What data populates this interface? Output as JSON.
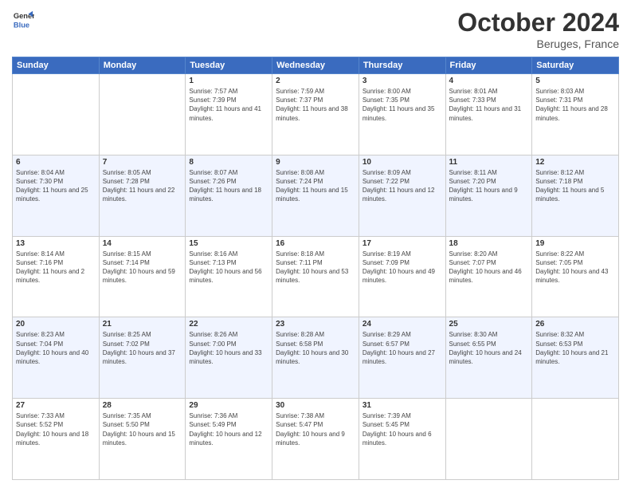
{
  "header": {
    "logo_line1": "General",
    "logo_line2": "Blue",
    "month": "October 2024",
    "location": "Beruges, France"
  },
  "days_of_week": [
    "Sunday",
    "Monday",
    "Tuesday",
    "Wednesday",
    "Thursday",
    "Friday",
    "Saturday"
  ],
  "weeks": [
    [
      {
        "day": "",
        "info": ""
      },
      {
        "day": "",
        "info": ""
      },
      {
        "day": "1",
        "info": "Sunrise: 7:57 AM\nSunset: 7:39 PM\nDaylight: 11 hours and 41 minutes."
      },
      {
        "day": "2",
        "info": "Sunrise: 7:59 AM\nSunset: 7:37 PM\nDaylight: 11 hours and 38 minutes."
      },
      {
        "day": "3",
        "info": "Sunrise: 8:00 AM\nSunset: 7:35 PM\nDaylight: 11 hours and 35 minutes."
      },
      {
        "day": "4",
        "info": "Sunrise: 8:01 AM\nSunset: 7:33 PM\nDaylight: 11 hours and 31 minutes."
      },
      {
        "day": "5",
        "info": "Sunrise: 8:03 AM\nSunset: 7:31 PM\nDaylight: 11 hours and 28 minutes."
      }
    ],
    [
      {
        "day": "6",
        "info": "Sunrise: 8:04 AM\nSunset: 7:30 PM\nDaylight: 11 hours and 25 minutes."
      },
      {
        "day": "7",
        "info": "Sunrise: 8:05 AM\nSunset: 7:28 PM\nDaylight: 11 hours and 22 minutes."
      },
      {
        "day": "8",
        "info": "Sunrise: 8:07 AM\nSunset: 7:26 PM\nDaylight: 11 hours and 18 minutes."
      },
      {
        "day": "9",
        "info": "Sunrise: 8:08 AM\nSunset: 7:24 PM\nDaylight: 11 hours and 15 minutes."
      },
      {
        "day": "10",
        "info": "Sunrise: 8:09 AM\nSunset: 7:22 PM\nDaylight: 11 hours and 12 minutes."
      },
      {
        "day": "11",
        "info": "Sunrise: 8:11 AM\nSunset: 7:20 PM\nDaylight: 11 hours and 9 minutes."
      },
      {
        "day": "12",
        "info": "Sunrise: 8:12 AM\nSunset: 7:18 PM\nDaylight: 11 hours and 5 minutes."
      }
    ],
    [
      {
        "day": "13",
        "info": "Sunrise: 8:14 AM\nSunset: 7:16 PM\nDaylight: 11 hours and 2 minutes."
      },
      {
        "day": "14",
        "info": "Sunrise: 8:15 AM\nSunset: 7:14 PM\nDaylight: 10 hours and 59 minutes."
      },
      {
        "day": "15",
        "info": "Sunrise: 8:16 AM\nSunset: 7:13 PM\nDaylight: 10 hours and 56 minutes."
      },
      {
        "day": "16",
        "info": "Sunrise: 8:18 AM\nSunset: 7:11 PM\nDaylight: 10 hours and 53 minutes."
      },
      {
        "day": "17",
        "info": "Sunrise: 8:19 AM\nSunset: 7:09 PM\nDaylight: 10 hours and 49 minutes."
      },
      {
        "day": "18",
        "info": "Sunrise: 8:20 AM\nSunset: 7:07 PM\nDaylight: 10 hours and 46 minutes."
      },
      {
        "day": "19",
        "info": "Sunrise: 8:22 AM\nSunset: 7:05 PM\nDaylight: 10 hours and 43 minutes."
      }
    ],
    [
      {
        "day": "20",
        "info": "Sunrise: 8:23 AM\nSunset: 7:04 PM\nDaylight: 10 hours and 40 minutes."
      },
      {
        "day": "21",
        "info": "Sunrise: 8:25 AM\nSunset: 7:02 PM\nDaylight: 10 hours and 37 minutes."
      },
      {
        "day": "22",
        "info": "Sunrise: 8:26 AM\nSunset: 7:00 PM\nDaylight: 10 hours and 33 minutes."
      },
      {
        "day": "23",
        "info": "Sunrise: 8:28 AM\nSunset: 6:58 PM\nDaylight: 10 hours and 30 minutes."
      },
      {
        "day": "24",
        "info": "Sunrise: 8:29 AM\nSunset: 6:57 PM\nDaylight: 10 hours and 27 minutes."
      },
      {
        "day": "25",
        "info": "Sunrise: 8:30 AM\nSunset: 6:55 PM\nDaylight: 10 hours and 24 minutes."
      },
      {
        "day": "26",
        "info": "Sunrise: 8:32 AM\nSunset: 6:53 PM\nDaylight: 10 hours and 21 minutes."
      }
    ],
    [
      {
        "day": "27",
        "info": "Sunrise: 7:33 AM\nSunset: 5:52 PM\nDaylight: 10 hours and 18 minutes."
      },
      {
        "day": "28",
        "info": "Sunrise: 7:35 AM\nSunset: 5:50 PM\nDaylight: 10 hours and 15 minutes."
      },
      {
        "day": "29",
        "info": "Sunrise: 7:36 AM\nSunset: 5:49 PM\nDaylight: 10 hours and 12 minutes."
      },
      {
        "day": "30",
        "info": "Sunrise: 7:38 AM\nSunset: 5:47 PM\nDaylight: 10 hours and 9 minutes."
      },
      {
        "day": "31",
        "info": "Sunrise: 7:39 AM\nSunset: 5:45 PM\nDaylight: 10 hours and 6 minutes."
      },
      {
        "day": "",
        "info": ""
      },
      {
        "day": "",
        "info": ""
      }
    ]
  ]
}
